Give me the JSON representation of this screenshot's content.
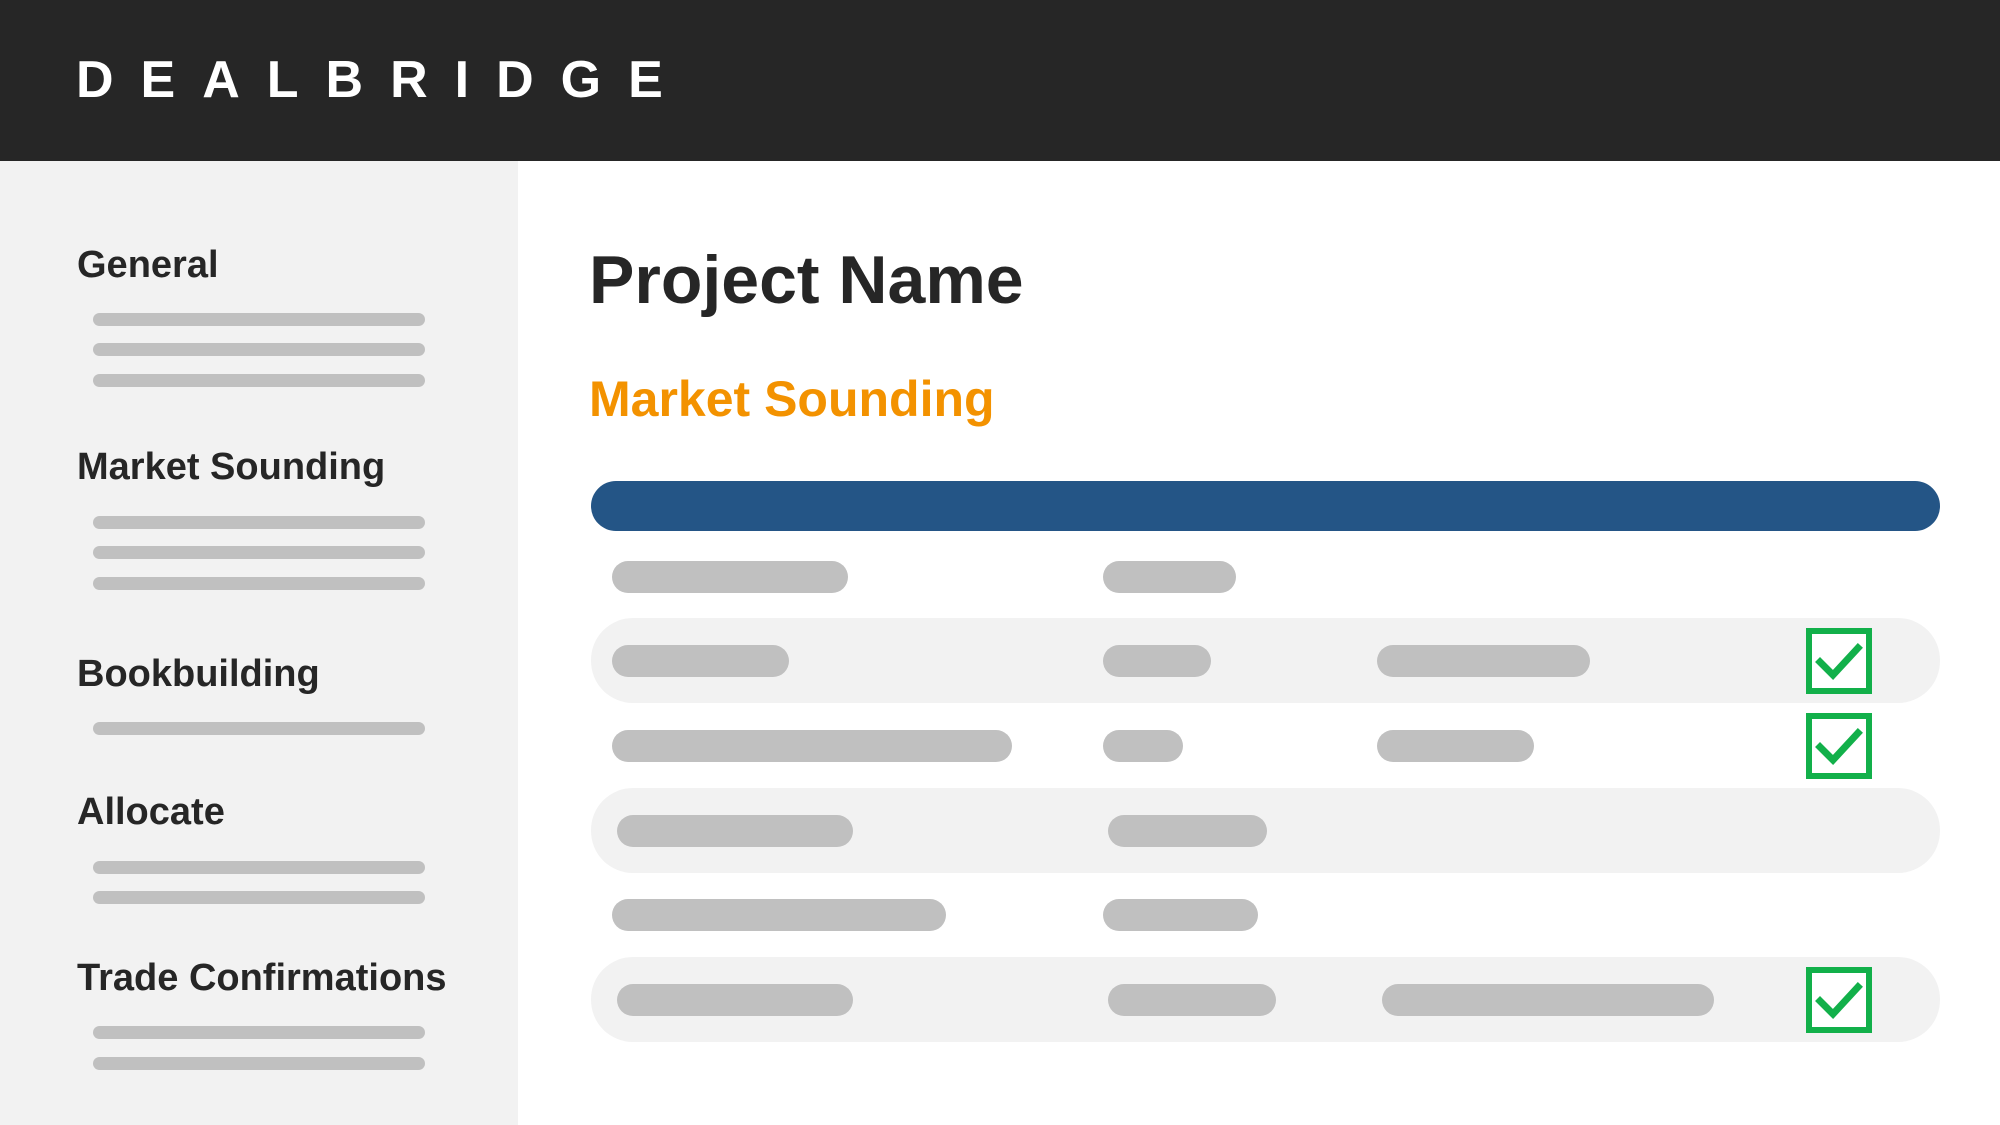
{
  "app": {
    "logo_text": "DEALBRIDGE"
  },
  "sidebar": {
    "sections": [
      {
        "label": "General",
        "placeholder_lines": 3
      },
      {
        "label": "Market Sounding",
        "placeholder_lines": 3
      },
      {
        "label": "Bookbuilding",
        "placeholder_lines": 1
      },
      {
        "label": "Allocate",
        "placeholder_lines": 2
      },
      {
        "label": "Trade Confirmations",
        "placeholder_lines": 2
      }
    ]
  },
  "main": {
    "page_title": "Project Name",
    "section_title": "Market Sounding",
    "table": {
      "rows": [
        {
          "shaded": false,
          "checked": false
        },
        {
          "shaded": true,
          "checked": true
        },
        {
          "shaded": false,
          "checked": true
        },
        {
          "shaded": true,
          "checked": false
        },
        {
          "shaded": false,
          "checked": false
        },
        {
          "shaded": true,
          "checked": true
        }
      ]
    }
  },
  "colors": {
    "topbar": "#262626",
    "sidebar": "#f2f2f2",
    "accent_orange": "#f39200",
    "table_header_blue": "#245586",
    "check_green": "#12b04a",
    "placeholder_gray": "#c0c0c0"
  },
  "icons": {
    "check": "checkbox-checked-icon"
  }
}
